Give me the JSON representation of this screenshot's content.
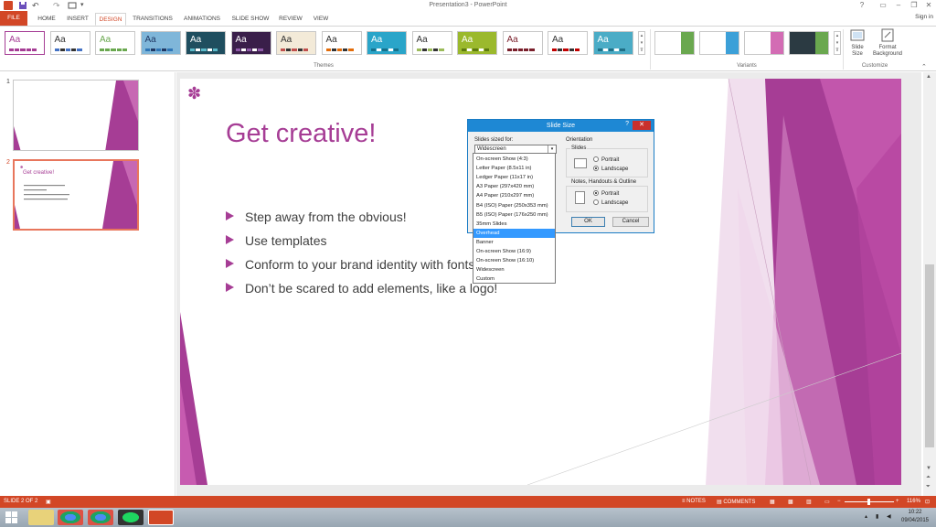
{
  "window": {
    "title": "Presentation3 - PowerPoint",
    "sign_in": "Sign in",
    "help": "?",
    "minimize": "–",
    "restore": "❐",
    "close": "✕"
  },
  "tabs": [
    {
      "label": "FILE"
    },
    {
      "label": "HOME"
    },
    {
      "label": "INSERT"
    },
    {
      "label": "DESIGN"
    },
    {
      "label": "TRANSITIONS"
    },
    {
      "label": "ANIMATIONS"
    },
    {
      "label": "SLIDE SHOW"
    },
    {
      "label": "REVIEW"
    },
    {
      "label": "VIEW"
    }
  ],
  "ribbon": {
    "themes_label": "Themes",
    "variants_label": "Variants",
    "customize_label": "Customize",
    "slide_size_label": "Slide Size",
    "format_background_label": "Format Background",
    "theme_sample": "Aa",
    "themes": [
      {
        "bg": "#ffffff",
        "fg": "#a63d95",
        "accent": "#a63d95"
      },
      {
        "bg": "#ffffff",
        "fg": "#333333",
        "accent": "#4472c4"
      },
      {
        "bg": "#ffffff",
        "fg": "#6aa84f",
        "accent": "#6aa84f"
      },
      {
        "bg": "#7fb6d9",
        "fg": "#1f3864",
        "accent": "#2e75b6"
      },
      {
        "bg": "#1f4e5f",
        "fg": "#ffffff",
        "accent": "#5bb9c9"
      },
      {
        "bg": "#3a1f4a",
        "fg": "#ffffff",
        "accent": "#8e5aa8"
      },
      {
        "bg": "#f3ead8",
        "fg": "#333333",
        "accent": "#c0504d"
      },
      {
        "bg": "#ffffff",
        "fg": "#333333",
        "accent": "#e36c09"
      },
      {
        "bg": "#2aa5c9",
        "fg": "#ffffff",
        "accent": "#16708a"
      },
      {
        "bg": "#ffffff",
        "fg": "#333333",
        "accent": "#9bbb59"
      },
      {
        "bg": "#9bb92d",
        "fg": "#ffffff",
        "accent": "#5d7a10"
      },
      {
        "bg": "#ffffff",
        "fg": "#7a1f2b",
        "accent": "#7a1f2b"
      },
      {
        "bg": "#ffffff",
        "fg": "#333333",
        "accent": "#c00000"
      },
      {
        "bg": "#4bacc6",
        "fg": "#ffffff",
        "accent": "#1f6f86"
      }
    ],
    "variants": [
      {
        "bg": "#ffffff",
        "accent": "#6aa84f"
      },
      {
        "bg": "#ffffff",
        "accent": "#3ca0d8"
      },
      {
        "bg": "#ffffff",
        "accent": "#d36cb4"
      },
      {
        "bg": "#2b3a42",
        "accent": "#6aa84f"
      }
    ]
  },
  "thumbnails": [
    {
      "number": "1",
      "selected": false
    },
    {
      "number": "2",
      "selected": true,
      "title": "Get creative!"
    }
  ],
  "slide": {
    "title": "Get creative!",
    "bullets": [
      "Step away from the obvious!",
      "Use templates",
      "Conform to your brand identity with fonts",
      "Don’t be scared to add elements, like a logo!"
    ],
    "logo_glyph": "✽",
    "accent_color": "#a63d95"
  },
  "dialog": {
    "title": "Slide Size",
    "help": "?",
    "close": "✕",
    "slides_sized_for_label": "Slides sized for:",
    "selected_value": "Widescreen",
    "orientation_label": "Orientation",
    "slides_label": "Slides",
    "notes_label": "Notes, Handouts & Outline",
    "portrait": "Portrait",
    "landscape": "Landscape",
    "ok": "OK",
    "cancel": "Cancel",
    "options": [
      "On-screen Show (4:3)",
      "Letter Paper (8.5x11 in)",
      "Ledger Paper (11x17 in)",
      "A3 Paper (297x420 mm)",
      "A4 Paper (210x297 mm)",
      "B4 (ISO) Paper (250x353 mm)",
      "B5 (ISO) Paper (176x250 mm)",
      "35mm Slides",
      "Overhead",
      "Banner",
      "On-screen Show (16:9)",
      "On-screen Show (16:10)",
      "Widescreen",
      "Custom"
    ],
    "highlighted_option": "Overhead"
  },
  "statusbar": {
    "slide_info": "SLIDE 2 OF 2",
    "notes": "NOTES",
    "comments": "COMMENTS",
    "zoom": "116%"
  },
  "taskbar": {
    "time": "10:22",
    "date": "09/04/2015"
  }
}
